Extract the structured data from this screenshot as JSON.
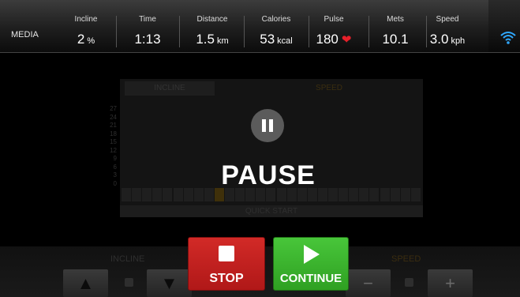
{
  "header": {
    "media_label": "MEDIA",
    "metrics": [
      {
        "label": "Incline",
        "value": "2",
        "unit": "%"
      },
      {
        "label": "Time",
        "value": "1:13",
        "unit": ""
      },
      {
        "label": "Distance",
        "value": "1.5",
        "unit": "km"
      },
      {
        "label": "Calories",
        "value": "53",
        "unit": "kcal"
      },
      {
        "label": "Pulse",
        "value": "180",
        "unit": ""
      },
      {
        "label": "Mets",
        "value": "10.1",
        "unit": ""
      },
      {
        "label": "Speed",
        "value": "3.0",
        "unit": "kph"
      }
    ],
    "wifi_icon": "wifi-icon",
    "heart_color": "#e8202a"
  },
  "chart": {
    "tab_incline": "INCLINE",
    "tab_speed": "SPEED",
    "y_ticks": [
      "27",
      "24",
      "21",
      "18",
      "15",
      "12",
      "9",
      "6",
      "3",
      "0"
    ],
    "footer": "QUICK START",
    "bar_count": 29,
    "active_bar_index": 9
  },
  "overlay": {
    "pause_icon": "pause-icon",
    "title": "PAUSE"
  },
  "controls": {
    "incline_label": "INCLINE",
    "speed_label": "SPEED",
    "stop_label": "STOP",
    "continue_label": "CONTINUE",
    "stop_color": "#c82020",
    "continue_color": "#3cb52e"
  }
}
